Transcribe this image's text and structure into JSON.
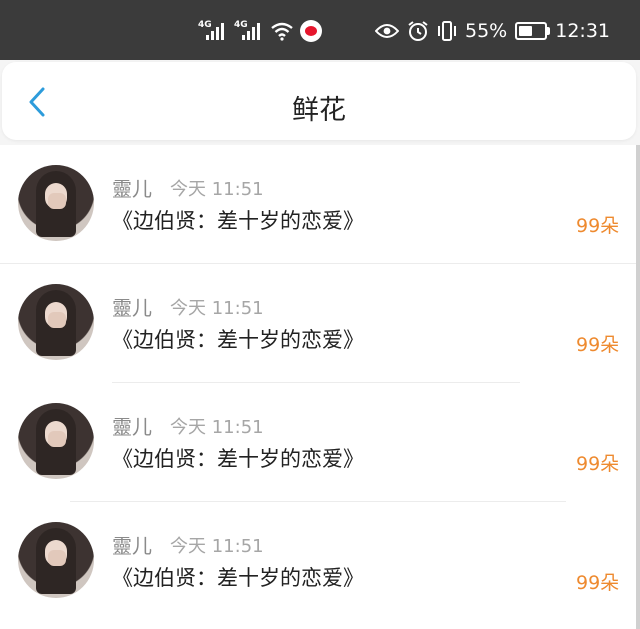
{
  "status_bar": {
    "network1": "4G",
    "network2": "4G",
    "battery_percent": "55%",
    "battery_level": 0.55,
    "time": "12:31",
    "icons": [
      "signal-icon",
      "signal-icon",
      "wifi-icon",
      "weibo-icon",
      "eye-icon",
      "alarm-icon",
      "vibrate-icon",
      "battery-icon"
    ]
  },
  "header": {
    "title": "鲜花",
    "back_icon": "chevron-left-icon"
  },
  "colors": {
    "accent": "#2d9cdb",
    "count": "#ee8a2f",
    "status_bar_bg": "#3b3b3b"
  },
  "items": [
    {
      "name": "靈儿",
      "time": "今天 11:51",
      "book": "《边伯贤：差十岁的恋爱》",
      "count": "99朵"
    },
    {
      "name": "靈儿",
      "time": "今天 11:51",
      "book": "《边伯贤：差十岁的恋爱》",
      "count": "99朵"
    },
    {
      "name": "靈儿",
      "time": "今天 11:51",
      "book": "《边伯贤：差十岁的恋爱》",
      "count": "99朵"
    },
    {
      "name": "靈儿",
      "time": "今天 11:51",
      "book": "《边伯贤：差十岁的恋爱》",
      "count": "99朵"
    }
  ]
}
